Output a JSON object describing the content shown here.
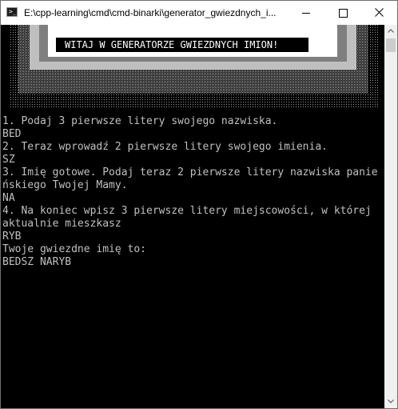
{
  "window": {
    "title": "E:\\cpp-learning\\cmd\\cmd-binarki\\generator_gwiezdnych_i...",
    "icon": "console-app-icon",
    "controls": [
      "minimize-icon",
      "maximize-icon",
      "close-icon"
    ]
  },
  "banner": {
    "text": "WITAJ W GENERATORZE GWIEZDNYCH IMION!",
    "frame_colors": [
      "#c0c0c0",
      "#808080",
      "#ffffff"
    ]
  },
  "console": {
    "lines": [
      "1. Podaj 3 pierwsze litery swojego nazwiska.",
      "BED",
      "2. Teraz wprowadź 2 pierwsze litery swojego imienia.",
      "SZ",
      "3. Imię gotowe. Podaj teraz 2 pierwsze litery nazwiska panie",
      "ńskiego Twojej Mamy.",
      "NA",
      "4. Na koniec wpisz 3 pierwsze litery miejscowości, w której",
      "aktualnie mieszkasz",
      "RYB",
      "Twoje gwiezdne imię to:",
      "BEDSZ NARYB"
    ]
  },
  "scrollbar": {
    "position": 0.0
  }
}
